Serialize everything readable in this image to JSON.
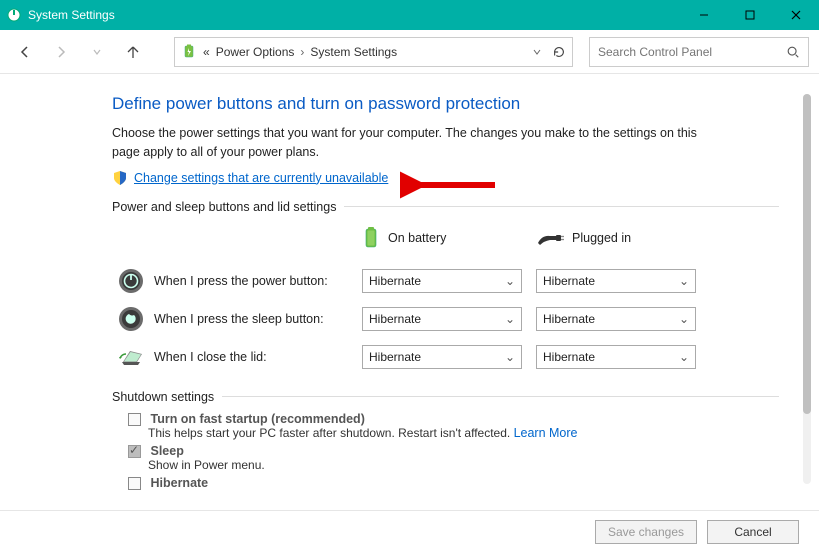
{
  "titlebar": {
    "title": "System Settings"
  },
  "nav": {
    "crumb_prefix": "«",
    "crumb1": "Power Options",
    "crumb2": "System Settings",
    "search_placeholder": "Search Control Panel"
  },
  "heading": "Define power buttons and turn on password protection",
  "intro": "Choose the power settings that you want for your computer. The changes you make to the settings on this page apply to all of your power plans.",
  "change_link": "Change settings that are currently unavailable",
  "section_buttons": "Power and sleep buttons and lid settings",
  "col_battery": "On battery",
  "col_plugged": "Plugged in",
  "rows": {
    "power": {
      "label": "When I press the power button:",
      "battery": "Hibernate",
      "plugged": "Hibernate"
    },
    "sleep": {
      "label": "When I press the sleep button:",
      "battery": "Hibernate",
      "plugged": "Hibernate"
    },
    "lid": {
      "label": "When I close the lid:",
      "battery": "Hibernate",
      "plugged": "Hibernate"
    }
  },
  "section_shutdown": "Shutdown settings",
  "shutdown": {
    "fast": {
      "title": "Turn on fast startup (recommended)",
      "desc": "This helps start your PC faster after shutdown. Restart isn't affected.",
      "learn": "Learn More"
    },
    "sleep": {
      "title": "Sleep",
      "desc": "Show in Power menu."
    },
    "hibernate": {
      "title": "Hibernate"
    }
  },
  "footer": {
    "save": "Save changes",
    "cancel": "Cancel"
  }
}
